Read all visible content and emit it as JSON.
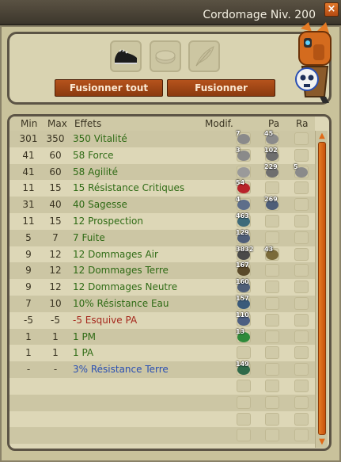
{
  "window": {
    "title": "Cordomage Niv. 200",
    "close_icon": "close-icon"
  },
  "slots": [
    {
      "name": "item-slot-shoe",
      "icon": "shoe-icon"
    },
    {
      "name": "item-slot-stone",
      "icon": "stone-icon"
    },
    {
      "name": "item-slot-feather",
      "icon": "feather-icon"
    }
  ],
  "buttons": {
    "fuse_all": "Fusionner tout",
    "fuse": "Fusionner"
  },
  "table": {
    "headers": {
      "min": "Min",
      "max": "Max",
      "effects": "Effets",
      "modif": "Modif.",
      "pa": "Pa",
      "ra": "Ra"
    },
    "rows": [
      {
        "min": "301",
        "max": "350",
        "effect": "350 Vitalité",
        "color": "green",
        "mod": "7",
        "pa": "45",
        "ra": ""
      },
      {
        "min": "41",
        "max": "60",
        "effect": "58 Force",
        "color": "green",
        "mod": "3",
        "pa": "102",
        "ra": ""
      },
      {
        "min": "41",
        "max": "60",
        "effect": "58 Agilité",
        "color": "green",
        "mod": "",
        "pa": "229",
        "ra": "5"
      },
      {
        "min": "11",
        "max": "15",
        "effect": "15 Résistance Critiques",
        "color": "green",
        "mod": "54",
        "pa": "",
        "ra": ""
      },
      {
        "min": "31",
        "max": "40",
        "effect": "40 Sagesse",
        "color": "green",
        "mod": "4",
        "pa": "269",
        "ra": ""
      },
      {
        "min": "11",
        "max": "15",
        "effect": "12 Prospection",
        "color": "green",
        "mod": "463",
        "pa": "",
        "ra": ""
      },
      {
        "min": "5",
        "max": "7",
        "effect": "7 Fuite",
        "color": "green",
        "mod": "129",
        "pa": "",
        "ra": ""
      },
      {
        "min": "9",
        "max": "12",
        "effect": "12 Dommages Air",
        "color": "green",
        "mod": "3832",
        "pa": "43",
        "ra": ""
      },
      {
        "min": "9",
        "max": "12",
        "effect": "12 Dommages Terre",
        "color": "green",
        "mod": "167",
        "pa": "",
        "ra": ""
      },
      {
        "min": "9",
        "max": "12",
        "effect": "12 Dommages Neutre",
        "color": "green",
        "mod": "160",
        "pa": "",
        "ra": ""
      },
      {
        "min": "7",
        "max": "10",
        "effect": "10% Résistance Eau",
        "color": "green",
        "mod": "157",
        "pa": "",
        "ra": ""
      },
      {
        "min": "-5",
        "max": "-5",
        "effect": "-5 Esquive PA",
        "color": "red",
        "mod": "110",
        "pa": "",
        "ra": ""
      },
      {
        "min": "1",
        "max": "1",
        "effect": "1 PM",
        "color": "green",
        "mod": "13",
        "pa": "",
        "ra": ""
      },
      {
        "min": "1",
        "max": "1",
        "effect": "1 PA",
        "color": "green",
        "mod": "",
        "pa": "",
        "ra": ""
      },
      {
        "min": "-",
        "max": "-",
        "effect": "3% Résistance Terre",
        "color": "blue",
        "mod": "149",
        "pa": "",
        "ra": ""
      },
      {
        "min": "",
        "max": "",
        "effect": "",
        "color": "green",
        "mod": "",
        "pa": "",
        "ra": ""
      },
      {
        "min": "",
        "max": "",
        "effect": "",
        "color": "green",
        "mod": "",
        "pa": "",
        "ra": ""
      },
      {
        "min": "",
        "max": "",
        "effect": "",
        "color": "green",
        "mod": "",
        "pa": "",
        "ra": ""
      },
      {
        "min": "",
        "max": "",
        "effect": "",
        "color": "green",
        "mod": "",
        "pa": "",
        "ra": ""
      }
    ]
  },
  "colors": {
    "accent": "#e06a17",
    "effect_green": "#2f6b15",
    "effect_red": "#a5271c",
    "effect_blue": "#2a4fb2"
  }
}
